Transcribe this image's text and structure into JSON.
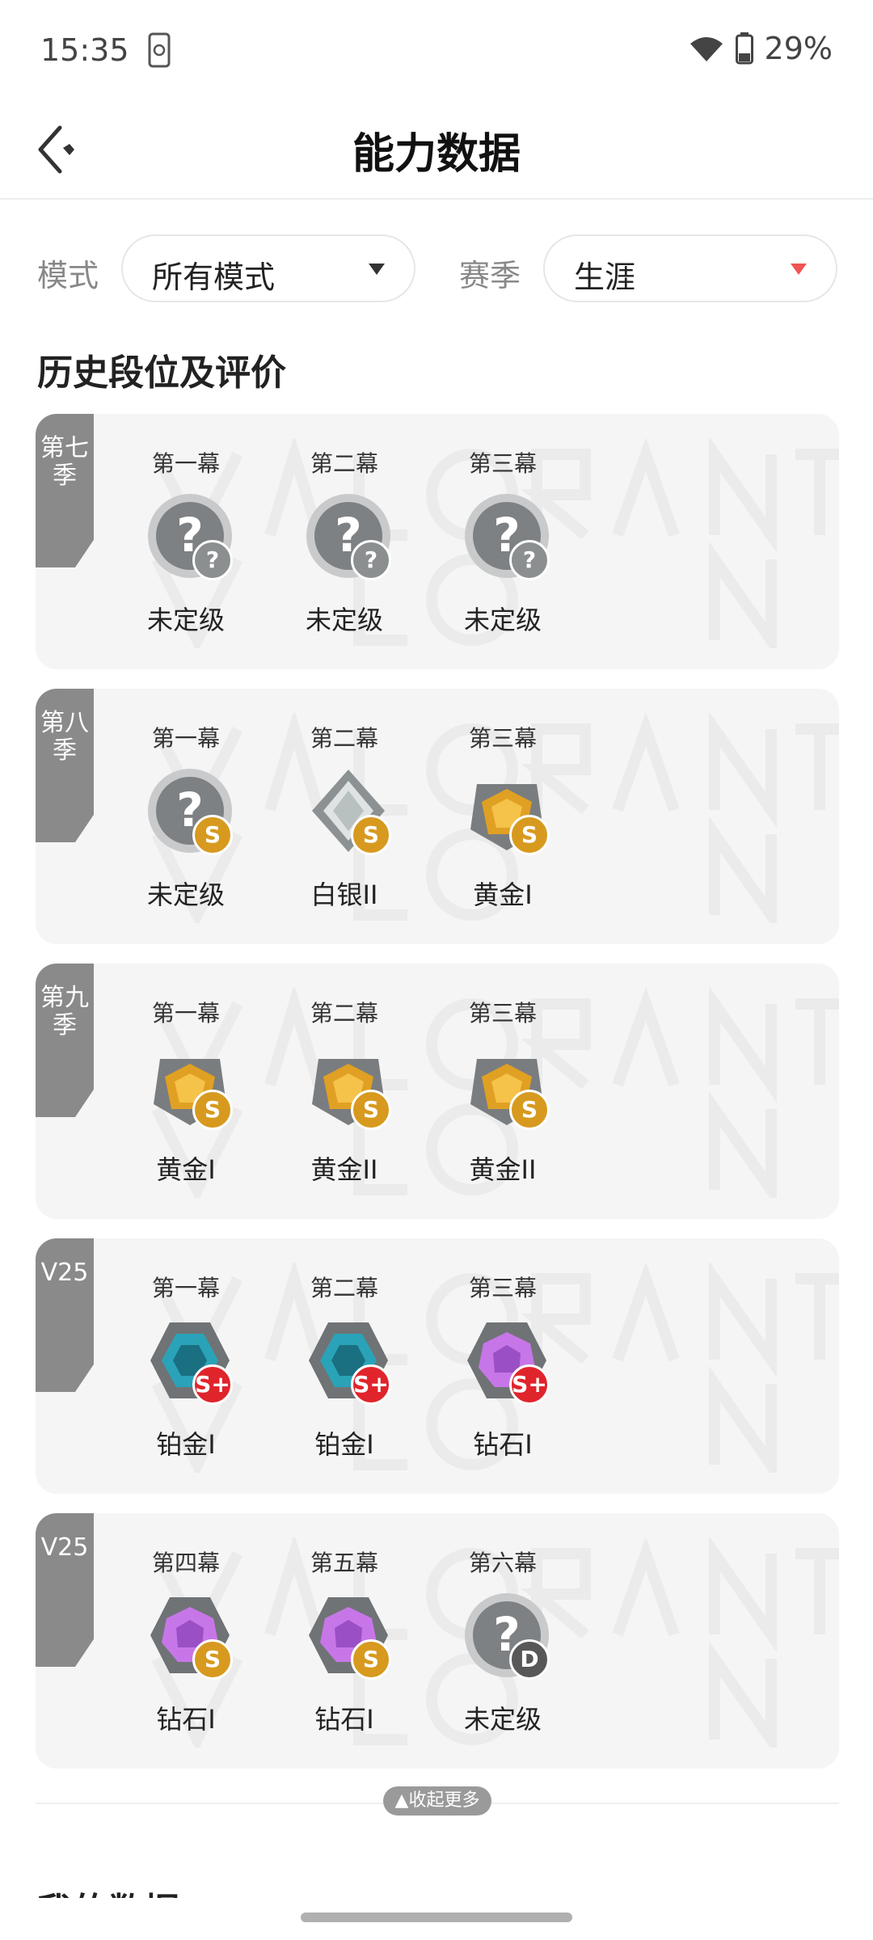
{
  "status": {
    "time": "15:35",
    "battery": "29%"
  },
  "header": {
    "title": "能力数据"
  },
  "filters": {
    "mode_label": "模式",
    "mode_value": "所有模式",
    "season_label": "赛季",
    "season_value": "生涯"
  },
  "section_title": "历史段位及评价",
  "cards": [
    {
      "tag": "第七季",
      "acts": [
        {
          "act": "第一幕",
          "rank": "未定级",
          "emblem": "unranked-icon",
          "grade": "?"
        },
        {
          "act": "第二幕",
          "rank": "未定级",
          "emblem": "unranked-icon",
          "grade": "?"
        },
        {
          "act": "第三幕",
          "rank": "未定级",
          "emblem": "unranked-icon",
          "grade": "?"
        }
      ]
    },
    {
      "tag": "第八季",
      "acts": [
        {
          "act": "第一幕",
          "rank": "未定级",
          "emblem": "unranked-icon",
          "grade": "S"
        },
        {
          "act": "第二幕",
          "rank": "白银II",
          "emblem": "silver-rank-icon",
          "grade": "S"
        },
        {
          "act": "第三幕",
          "rank": "黄金I",
          "emblem": "gold-rank-icon",
          "grade": "S"
        }
      ]
    },
    {
      "tag": "第九季",
      "acts": [
        {
          "act": "第一幕",
          "rank": "黄金I",
          "emblem": "gold-rank-icon",
          "grade": "S"
        },
        {
          "act": "第二幕",
          "rank": "黄金II",
          "emblem": "gold-rank-icon",
          "grade": "S"
        },
        {
          "act": "第三幕",
          "rank": "黄金II",
          "emblem": "gold-rank-icon",
          "grade": "S"
        }
      ]
    },
    {
      "tag": "V25",
      "acts": [
        {
          "act": "第一幕",
          "rank": "铂金I",
          "emblem": "platinum-rank-icon",
          "grade": "S+"
        },
        {
          "act": "第二幕",
          "rank": "铂金I",
          "emblem": "platinum-rank-icon",
          "grade": "S+"
        },
        {
          "act": "第三幕",
          "rank": "钻石I",
          "emblem": "diamond-rank-icon",
          "grade": "S+"
        }
      ]
    },
    {
      "tag": "V25",
      "acts": [
        {
          "act": "第四幕",
          "rank": "钻石I",
          "emblem": "diamond-rank-icon",
          "grade": "S"
        },
        {
          "act": "第五幕",
          "rank": "钻石I",
          "emblem": "diamond-rank-icon",
          "grade": "S"
        },
        {
          "act": "第六幕",
          "rank": "未定级",
          "emblem": "unranked-icon",
          "grade": "D"
        }
      ]
    }
  ],
  "collapse_label": "▲收起更多",
  "next_section_title": "我的数据"
}
